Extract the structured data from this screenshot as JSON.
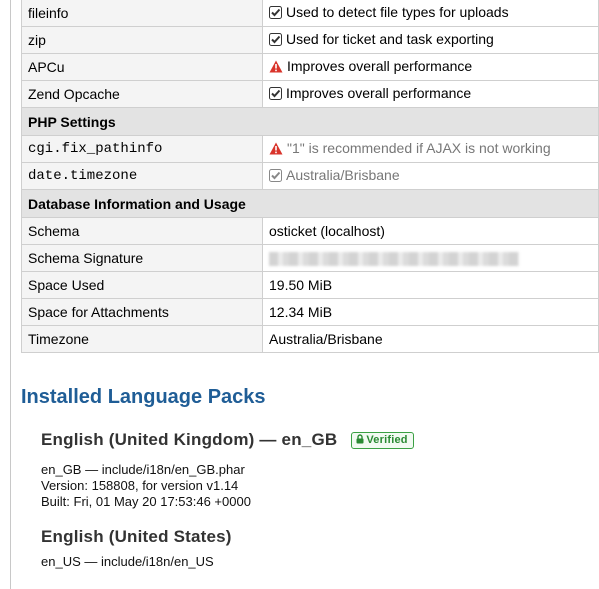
{
  "extensions": [
    {
      "name": "fileinfo",
      "status": "ok",
      "text": "Used to detect file types for uploads"
    },
    {
      "name": "zip",
      "status": "ok",
      "text": "Used for ticket and task exporting"
    },
    {
      "name": "APCu",
      "status": "warn",
      "text": "Improves overall performance"
    },
    {
      "name": "Zend Opcache",
      "status": "ok",
      "text": "Improves overall performance"
    }
  ],
  "php_settings": {
    "header": "PHP Settings",
    "rows": [
      {
        "name": "cgi.fix_pathinfo",
        "status": "warn",
        "text": "\"1\" is recommended if AJAX is not working"
      },
      {
        "name": "date.timezone",
        "status": "ok",
        "text": "Australia/Brisbane"
      }
    ]
  },
  "database": {
    "header": "Database Information and Usage",
    "schema_label": "Schema",
    "schema_value": "osticket (localhost)",
    "signature_label": "Schema Signature",
    "space_used_label": "Space Used",
    "space_used_value": "19.50 MiB",
    "attachments_label": "Space for Attachments",
    "attachments_value": "12.34 MiB",
    "timezone_label": "Timezone",
    "timezone_value": "Australia/Brisbane"
  },
  "language_packs": {
    "title": "Installed Language Packs",
    "packs": [
      {
        "name": "English (United Kingdom) — en_GB",
        "badge": "Verified",
        "path": "en_GB — include/i18n/en_GB.phar",
        "version": "Version: 158808, for version v1.14",
        "built": "Built: Fri, 01 May 20 17:53:46 +0000"
      },
      {
        "name": "English (United States)",
        "path": "en_US — include/i18n/en_US"
      }
    ]
  },
  "colors": {
    "heading": "#1f5d96",
    "warn": "#d9342b",
    "verified": "#2a8a33"
  },
  "icons": {
    "ok": "checkbox-checked-icon",
    "warn": "warning-triangle-icon",
    "verified": "lock-icon"
  }
}
